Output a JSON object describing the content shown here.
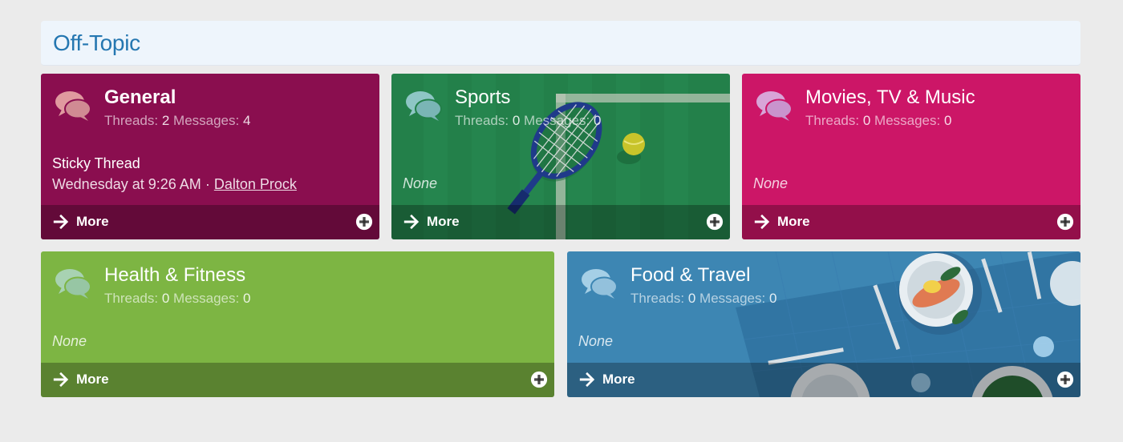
{
  "category": {
    "title": "Off-Topic"
  },
  "nodes": [
    {
      "name": "General",
      "threads_label": "Threads:",
      "threads": "2",
      "messages_label": "Messages:",
      "messages": "4",
      "latest_title": "Sticky Thread",
      "latest_time": "Wednesday at 9:26 AM",
      "latest_sep": "·",
      "latest_user": "Dalton Prock",
      "more_label": "More",
      "color": "#8a0e4f"
    },
    {
      "name": "Sports",
      "threads_label": "Threads:",
      "threads": "0",
      "messages_label": "Messages:",
      "messages": "0",
      "latest_none": "None",
      "more_label": "More",
      "color": "#23804a"
    },
    {
      "name": "Movies, TV & Music",
      "threads_label": "Threads:",
      "threads": "0",
      "messages_label": "Messages:",
      "messages": "0",
      "latest_none": "None",
      "more_label": "More",
      "color": "#cc1667"
    },
    {
      "name": "Health & Fitness",
      "threads_label": "Threads:",
      "threads": "0",
      "messages_label": "Messages:",
      "messages": "0",
      "latest_none": "None",
      "more_label": "More",
      "color": "#7db543"
    },
    {
      "name": "Food & Travel",
      "threads_label": "Threads:",
      "threads": "0",
      "messages_label": "Messages:",
      "messages": "0",
      "latest_none": "None",
      "more_label": "More",
      "color": "#3d86b3"
    }
  ]
}
